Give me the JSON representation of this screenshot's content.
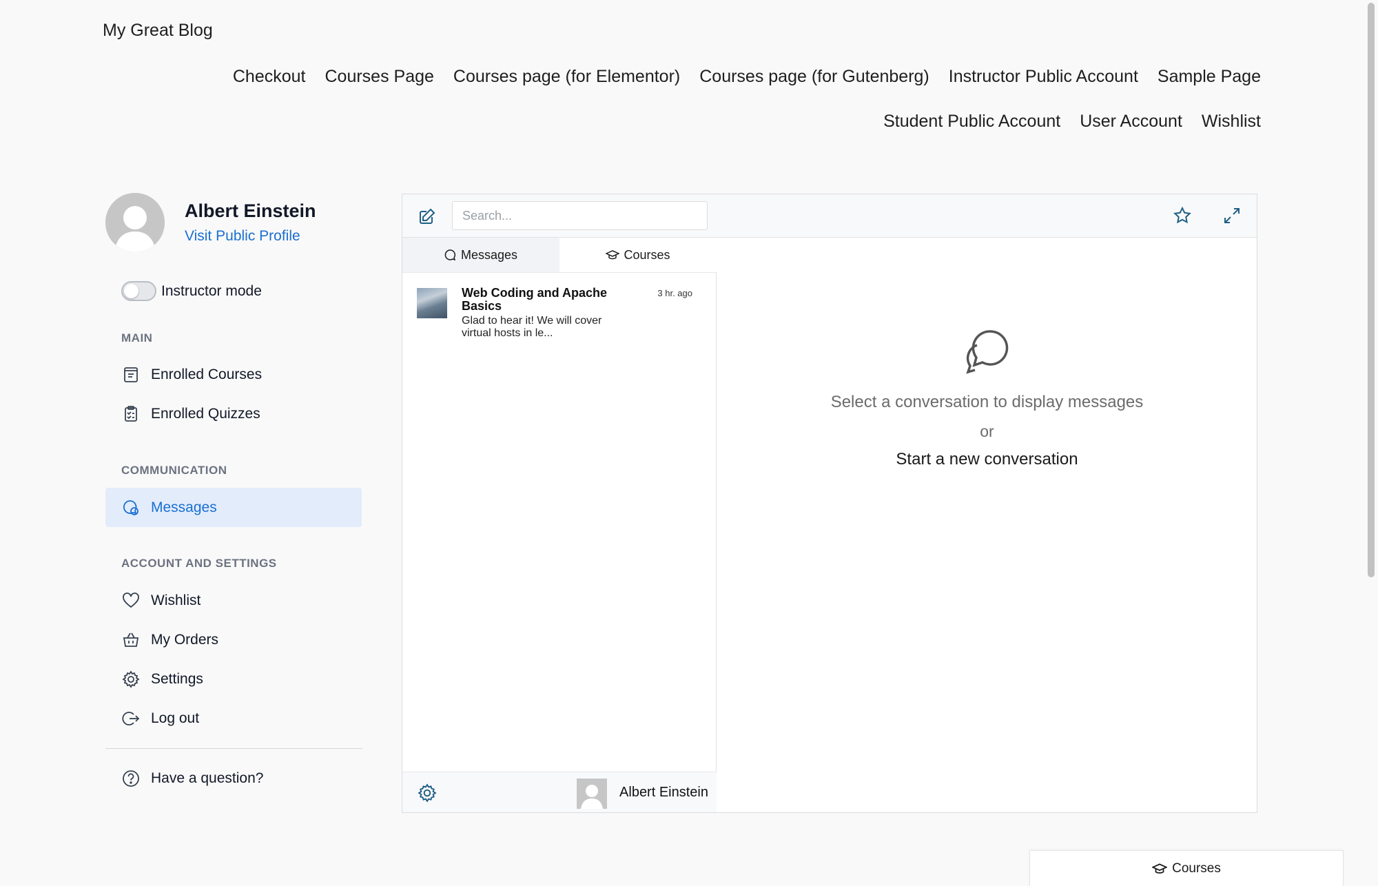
{
  "site": {
    "title": "My Great Blog"
  },
  "nav": {
    "row1": [
      "Checkout",
      "Courses Page",
      "Courses page (for Elementor)",
      "Courses page (for Gutenberg)",
      "Instructor Public Account",
      "Sample Page"
    ],
    "row2": [
      "Student Public Account",
      "User Account",
      "Wishlist"
    ]
  },
  "profile": {
    "name": "Albert Einstein",
    "link": "Visit Public Profile"
  },
  "instructor_mode": {
    "label": "Instructor mode",
    "enabled": false
  },
  "sidebar": {
    "main_title": "MAIN",
    "enrolled_courses": "Enrolled Courses",
    "enrolled_quizzes": "Enrolled Quizzes",
    "communication_title": "COMMUNICATION",
    "messages": "Messages",
    "account_title": "ACCOUNT AND SETTINGS",
    "wishlist": "Wishlist",
    "my_orders": "My Orders",
    "settings": "Settings",
    "log_out": "Log out",
    "question": "Have a question?"
  },
  "messenger": {
    "search_placeholder": "Search...",
    "tabs": {
      "messages": "Messages",
      "courses": "Courses"
    },
    "conversation": {
      "title": "Web Coding and Apache Basics",
      "time": "3 hr. ago",
      "snippet": "Glad to hear it! We will cover virtual hosts in le..."
    },
    "footer_user": "Albert Einstein",
    "empty": {
      "line1": "Select a conversation to display messages",
      "or": "or",
      "start": "Start a new conversation"
    }
  },
  "floating": {
    "courses": "Courses"
  },
  "colors": {
    "accent": "#1a6fd1",
    "active_bg": "#e2ecfb",
    "icon_teal": "#1f5f85"
  }
}
